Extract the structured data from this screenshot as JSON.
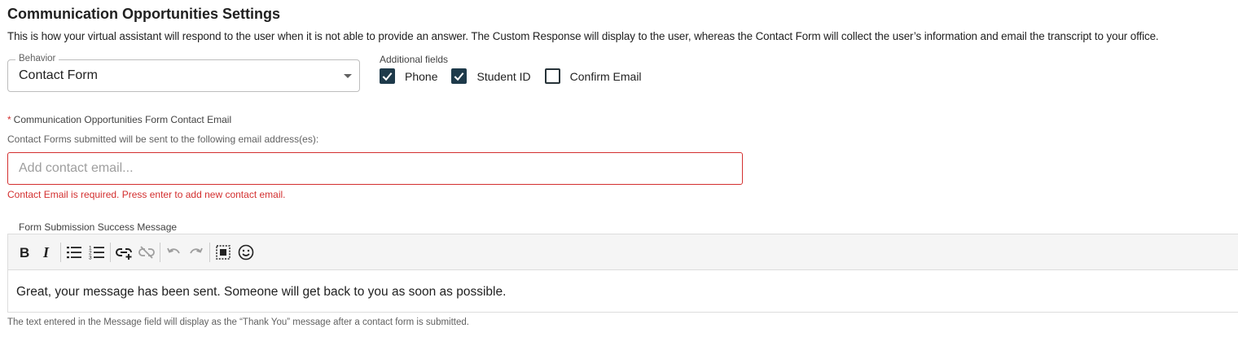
{
  "page": {
    "title": "Communication Opportunities Settings",
    "description": "This is how your virtual assistant will respond to the user when it is not able to provide an answer. The Custom Response will display to the user, whereas the Contact Form will collect the user’s information and email the transcript to your office."
  },
  "behavior": {
    "label": "Behavior",
    "value": "Contact Form"
  },
  "additional_fields": {
    "label": "Additional fields",
    "options": [
      {
        "label": "Phone",
        "checked": true
      },
      {
        "label": "Student ID",
        "checked": true
      },
      {
        "label": "Confirm Email",
        "checked": false
      }
    ]
  },
  "contact_email": {
    "required_marker": "*",
    "label": "Communication Opportunities Form Contact Email",
    "sublabel": "Contact Forms submitted will be sent to the following email address(es):",
    "placeholder": "Add contact email...",
    "value": "",
    "error": "Contact Email is required. Press enter to add new contact email."
  },
  "success_message": {
    "label": "Form Submission Success Message",
    "content": "Great, your message has been sent. Someone will get back to you as soon as possible.",
    "footnote": "The text entered in the Message field will display as the “Thank You” message after a contact form is submitted.",
    "toolbar_icons": [
      "bold-icon",
      "italic-icon",
      "bulleted-list-icon",
      "numbered-list-icon",
      "insert-link-icon",
      "unlink-icon",
      "undo-icon",
      "redo-icon",
      "select-all-icon",
      "emoji-icon"
    ]
  },
  "colors": {
    "error": "#d32f2f",
    "checkbox_checked": "#1e3a4a"
  }
}
